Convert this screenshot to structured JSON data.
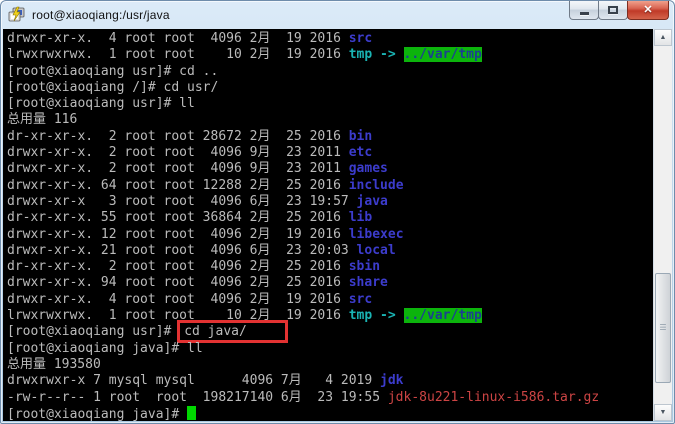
{
  "colors": {
    "fg": "#bbbbbb",
    "dir": "#3c3ccc",
    "cyan": "#1ab4b4",
    "greenbg-bg": "#0cb40c",
    "greenbg-fg": "#1c4090",
    "red": "#cc4444",
    "cursor": "#00d800",
    "annotation": "#e23232"
  },
  "window": {
    "title": "root@xiaoqiang:/usr/java",
    "app_icon": "putty-terminal-icon",
    "controls": {
      "minimize": "minimize",
      "maximize": "maximize",
      "close_glyph": "✕"
    }
  },
  "scrollbar": {
    "up_icon": "▲",
    "down_icon": "▼",
    "grip_icon": "☰"
  },
  "terminal": {
    "cursor_visible": true,
    "lines": [
      [
        {
          "t": "drwxr-xr-x.  4 root root  4096 2月  19 2016 ",
          "s": "fg"
        },
        {
          "t": "src",
          "s": "dir"
        }
      ],
      [
        {
          "t": "lrwxrwxrwx.  1 root root    10 2月  19 2016 ",
          "s": "fg"
        },
        {
          "t": "tmp -> ",
          "s": "cyan"
        },
        {
          "t": "../var/tmp",
          "s": "greenbg"
        }
      ],
      [
        {
          "t": "[root@xiaoqiang usr]# cd ..",
          "s": "fg"
        }
      ],
      [
        {
          "t": "[root@xiaoqiang /]# cd usr/",
          "s": "fg"
        }
      ],
      [
        {
          "t": "[root@xiaoqiang usr]# ll",
          "s": "fg"
        }
      ],
      [
        {
          "t": "总用量 116",
          "s": "fg"
        }
      ],
      [
        {
          "t": "dr-xr-xr-x.  2 root root 28672 2月  25 2016 ",
          "s": "fg"
        },
        {
          "t": "bin",
          "s": "dir"
        }
      ],
      [
        {
          "t": "drwxr-xr-x.  2 root root  4096 9月  23 2011 ",
          "s": "fg"
        },
        {
          "t": "etc",
          "s": "dir"
        }
      ],
      [
        {
          "t": "drwxr-xr-x.  2 root root  4096 9月  23 2011 ",
          "s": "fg"
        },
        {
          "t": "games",
          "s": "dir"
        }
      ],
      [
        {
          "t": "drwxr-xr-x. 64 root root 12288 2月  25 2016 ",
          "s": "fg"
        },
        {
          "t": "include",
          "s": "dir"
        }
      ],
      [
        {
          "t": "drwxr-xr-x   3 root root  4096 6月  23 19:57 ",
          "s": "fg"
        },
        {
          "t": "java",
          "s": "dir"
        }
      ],
      [
        {
          "t": "dr-xr-xr-x. 55 root root 36864 2月  25 2016 ",
          "s": "fg"
        },
        {
          "t": "lib",
          "s": "dir"
        }
      ],
      [
        {
          "t": "drwxr-xr-x. 12 root root  4096 2月  19 2016 ",
          "s": "fg"
        },
        {
          "t": "libexec",
          "s": "dir"
        }
      ],
      [
        {
          "t": "drwxr-xr-x. 21 root root  4096 6月  23 20:03 ",
          "s": "fg"
        },
        {
          "t": "local",
          "s": "dir"
        }
      ],
      [
        {
          "t": "dr-xr-xr-x.  2 root root  4096 2月  25 2016 ",
          "s": "fg"
        },
        {
          "t": "sbin",
          "s": "dir"
        }
      ],
      [
        {
          "t": "drwxr-xr-x. 94 root root  4096 2月  25 2016 ",
          "s": "fg"
        },
        {
          "t": "share",
          "s": "dir"
        }
      ],
      [
        {
          "t": "drwxr-xr-x.  4 root root  4096 2月  19 2016 ",
          "s": "fg"
        },
        {
          "t": "src",
          "s": "dir"
        }
      ],
      [
        {
          "t": "lrwxrwxrwx.  1 root root    10 2月  19 2016 ",
          "s": "fg"
        },
        {
          "t": "tmp -> ",
          "s": "cyan"
        },
        {
          "t": "../var/tmp",
          "s": "greenbg"
        }
      ],
      [
        {
          "t": "[root@xiaoqiang usr]# ",
          "s": "fg"
        },
        {
          "t": "cd java/",
          "s": "boxed"
        }
      ],
      [
        {
          "t": "[root@xiaoqiang java]# ll",
          "s": "fg"
        }
      ],
      [
        {
          "t": "总用量 193580",
          "s": "fg"
        }
      ],
      [
        {
          "t": "drwxrwxr-x 7 mysql mysql      4096 7月   4 2019 ",
          "s": "fg"
        },
        {
          "t": "jdk",
          "s": "dir"
        }
      ],
      [
        {
          "t": "-rw-r--r-- 1 root  root  198217140 6月  23 19:55 ",
          "s": "fg"
        },
        {
          "t": "jdk-8u221-linux-i586.tar.gz",
          "s": "red"
        }
      ],
      [
        {
          "t": "[root@xiaoqiang java]# ",
          "s": "fg"
        },
        {
          "t": "",
          "s": "cursor"
        }
      ]
    ]
  }
}
